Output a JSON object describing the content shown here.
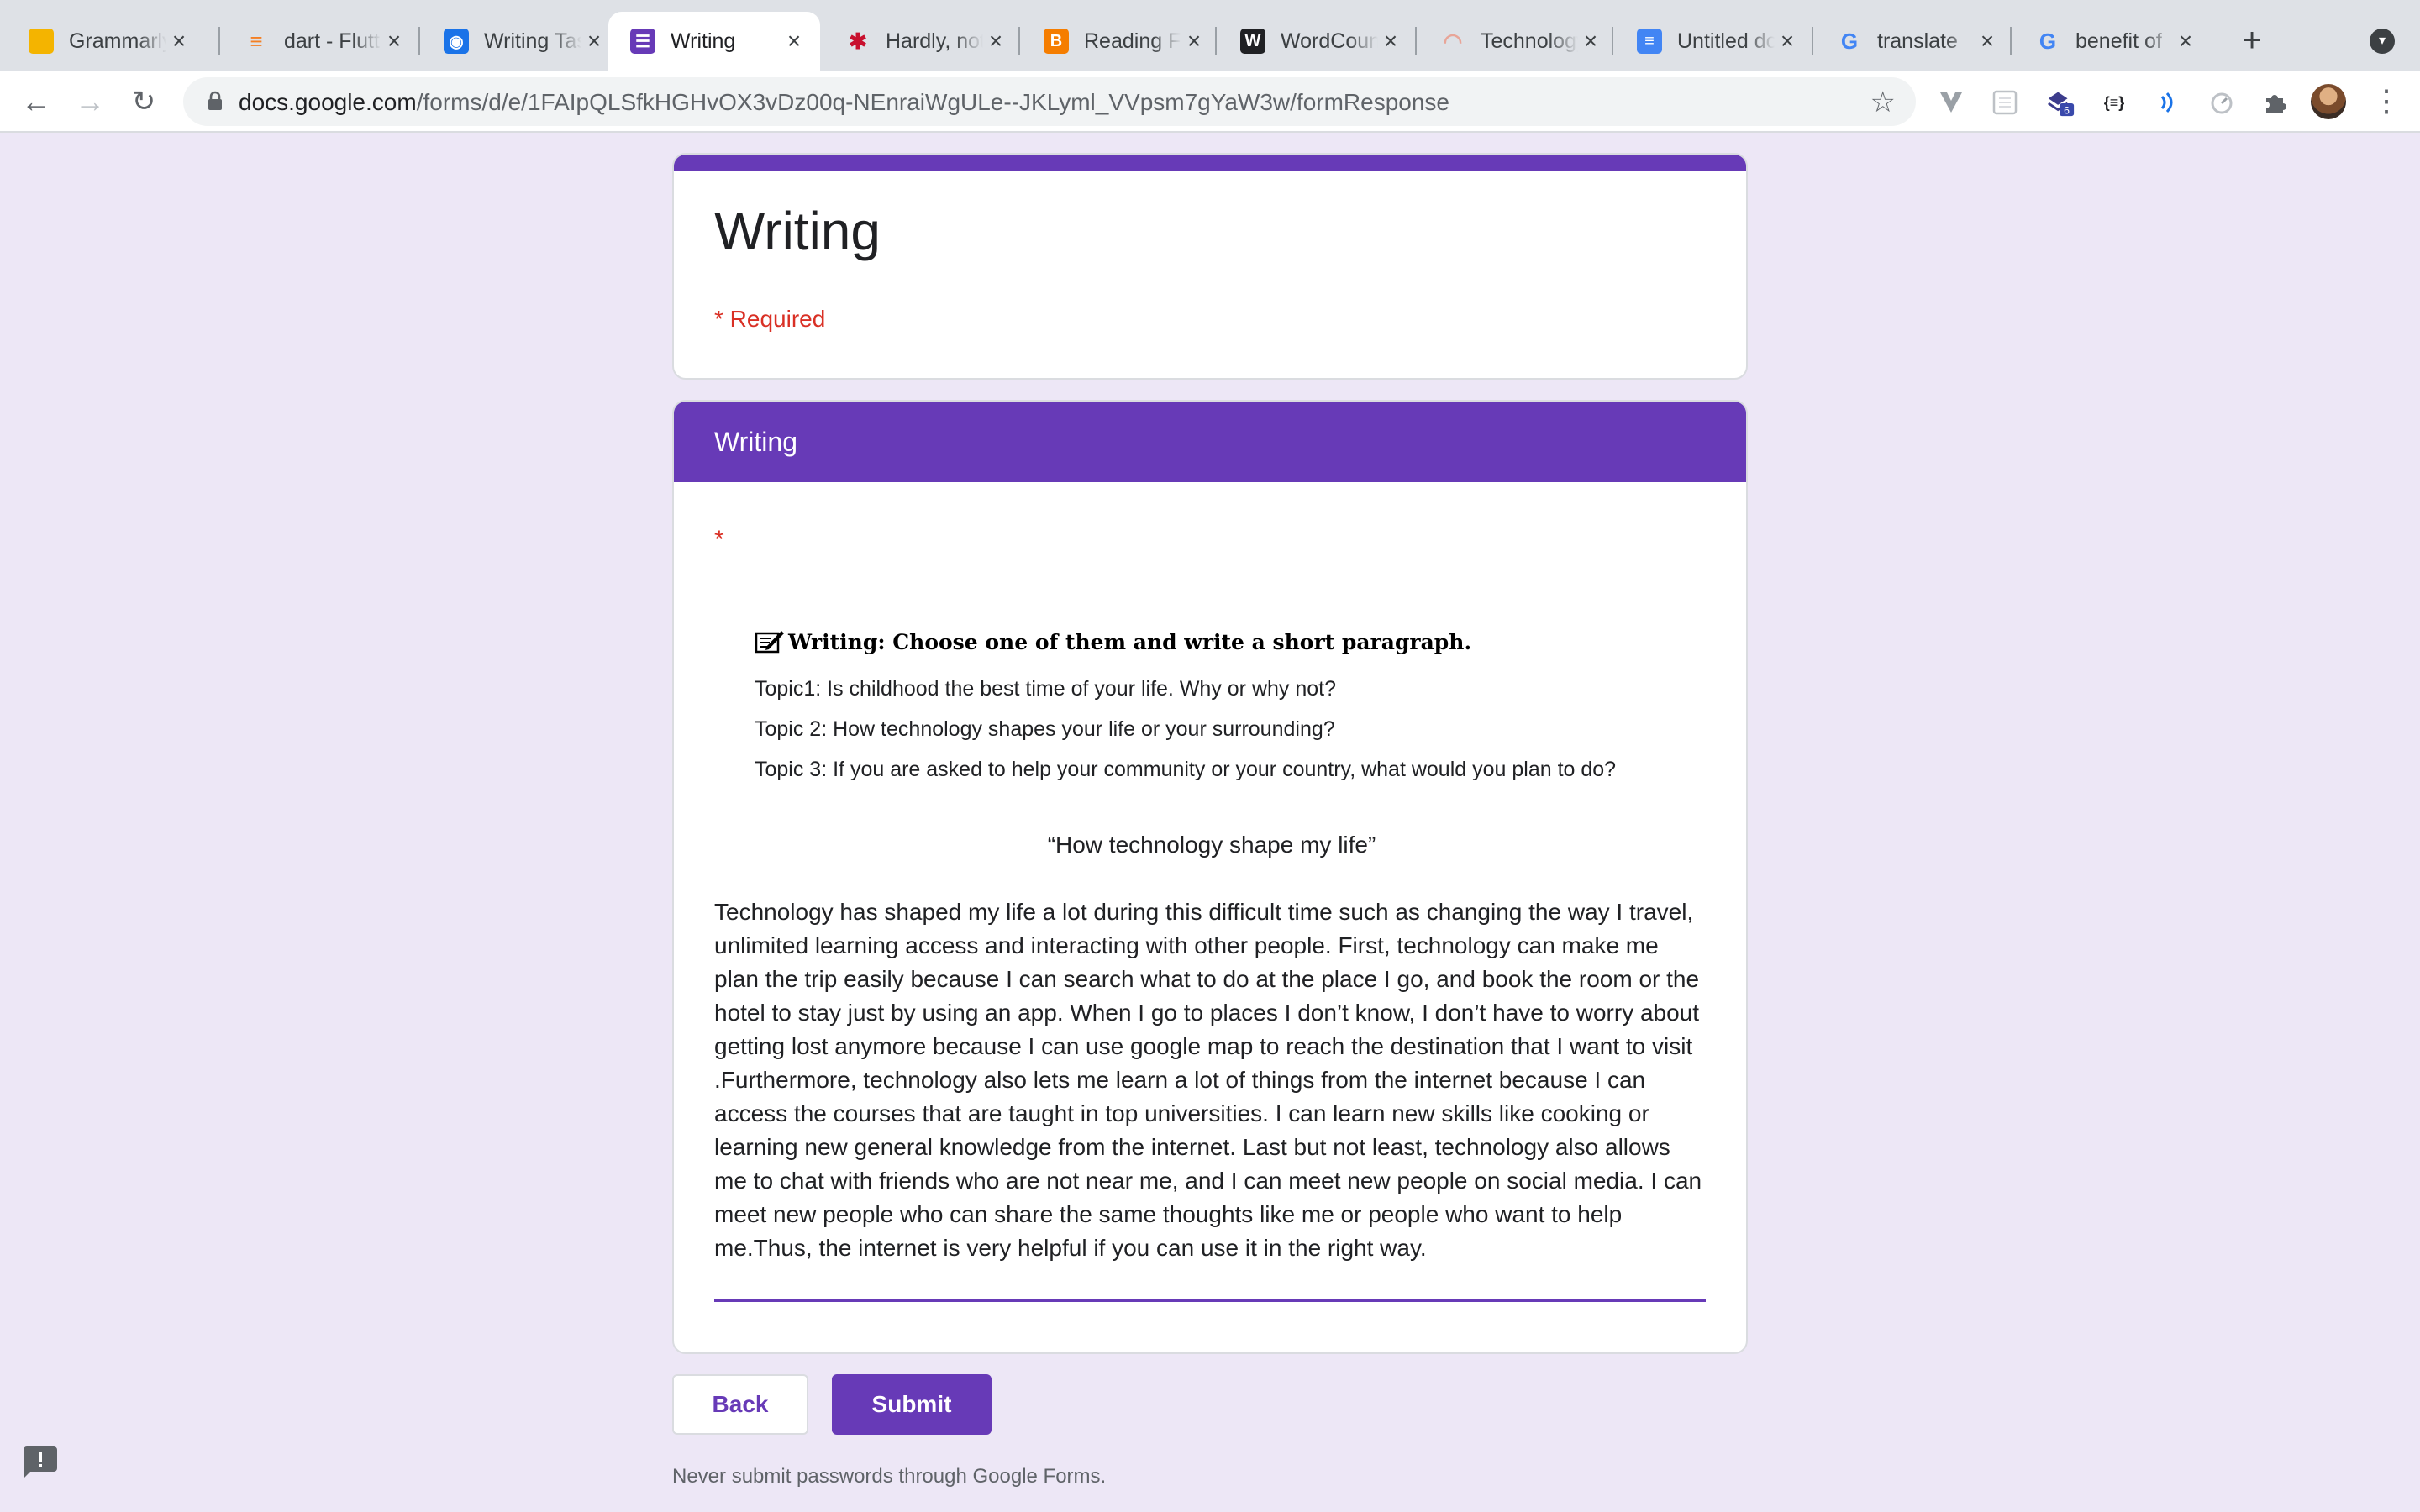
{
  "tabs": [
    {
      "title": "Grammarly",
      "favicon": "slides-icon",
      "color": "#f4b400",
      "active": false
    },
    {
      "title": "dart - Flutter",
      "favicon": "stackoverflow-icon",
      "color": "#f48024",
      "active": false
    },
    {
      "title": "Writing Task",
      "favicon": "classroom-icon",
      "color": "#1a73e8",
      "active": false
    },
    {
      "title": "Writing",
      "favicon": "forms-icon",
      "color": "#673ab7",
      "active": true
    },
    {
      "title": "Hardly, not",
      "favicon": "uk-flag-icon",
      "color": "#c8102e",
      "active": false
    },
    {
      "title": "Reading F",
      "favicon": "blogger-icon",
      "color": "#f57d00",
      "active": false
    },
    {
      "title": "WordCounter",
      "favicon": "wordcounter-icon",
      "color": "#202124",
      "active": false
    },
    {
      "title": "Technology",
      "favicon": "brain-icon",
      "color": "#e8a598",
      "active": false
    },
    {
      "title": "Untitled document",
      "favicon": "docs-icon",
      "color": "#4285f4",
      "active": false
    },
    {
      "title": "translate",
      "favicon": "google-icon",
      "color": "#4285f4",
      "active": false
    },
    {
      "title": "benefit of",
      "favicon": "google-icon",
      "color": "#4285f4",
      "active": false
    }
  ],
  "address_bar": {
    "domain": "docs.google.com",
    "path": "/forms/d/e/1FAIpQLSfkHGHvOX3vDz00q-NEnraiWgULe--JKLyml_VVpsm7gYaW3w/formResponse"
  },
  "extensions": {
    "badge_count": "6",
    "json_label": "{≡}"
  },
  "form": {
    "title": "Writing",
    "required_note": "* Required",
    "accent": "#673ab7",
    "section_title": "Writing",
    "required_star": "*",
    "prompt": {
      "heading": "Writing: Choose one of them and write a short paragraph.",
      "topics": [
        "Topic1: Is childhood the best time of your life. Why or why not?",
        "Topic 2: How technology shapes your life or your surrounding?",
        "Topic 3: If you are asked to help your community or your country, what would you plan to do?"
      ]
    },
    "answer": {
      "title": "“How technology shape my life”",
      "body": "Technology has shaped my life a lot during this difficult time such as changing the way I travel, unlimited learning access and interacting with other people. First, technology can make me plan the trip easily because I can search what to do at the place I go, and book the room or the hotel to stay just by using an app. When I go to places I don’t know, I don’t have to worry about getting lost anymore because I can use google map to reach the destination that I want to visit .Furthermore, technology also lets me learn a lot of things from the internet because I can access the courses that are taught in top universities. I can learn new skills like cooking or learning new general knowledge from the internet. Last but not least, technology also allows me to chat with friends who are not near me, and I can meet new people on social media. I can meet new people who can share the same thoughts like me or people who want to help me.Thus, the internet is very helpful if you can use it in the right way."
    },
    "back_label": "Back",
    "submit_label": "Submit",
    "footer_note": "Never submit passwords through Google Forms."
  }
}
